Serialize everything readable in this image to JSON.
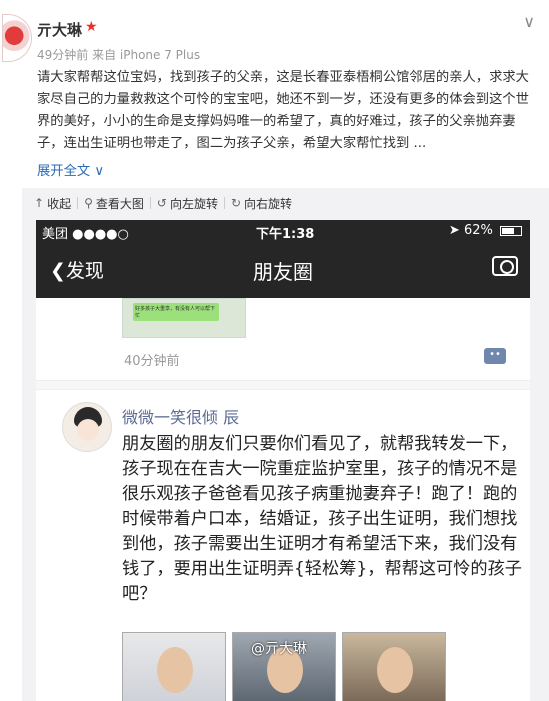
{
  "post": {
    "username": "亓大琳",
    "meta": "49分钟前 来自 iPhone 7 Plus",
    "text": "请大家帮帮这位宝妈，找到孩子的父亲，这是长春亚泰梧桐公馆邻居的亲人，求求大家尽自己的力量救救这个可怜的宝宝吧，她还不到一岁，还没有更多的体会到这个世界的美好，小小的生命是支撑妈妈唯一的希望了，真的好难过，孩子的父亲抛弃妻子，连出生证明也带走了，图二为孩子父亲，希望大家帮忙找到 ...",
    "expand_label": "展开全文 ∨",
    "colors": {
      "link": "#2a6bb5",
      "star": "#e8312f"
    }
  },
  "toolbar": {
    "collapse": "收起",
    "view_large": "查看大图",
    "rotate_left": "向左旋转",
    "rotate_right": "向右旋转"
  },
  "phone": {
    "carrier": "美团 ●●●●○",
    "time": "下午1:38",
    "battery": "62%",
    "back_label": "发现",
    "title": "朋友圈",
    "prev_time": "40分钟前",
    "prev_bubble": "好多孩子大重享，有没有人可以帮下忙",
    "moment_name": "微微一笑很倾 辰",
    "moment_text": "朋友圈的朋友们只要你们看见了，就帮我转发一下，孩子现在在吉大一院重症监护室里，孩子的情况不是很乐观孩子爸爸看见孩子病重抛妻弃子！跑了！跑的时候带着户口本，结婚证，孩子出生证明，我们想找到他，孩子需要出生证明才有希望活下来，我们没有钱了，要用出生证明弄{轻松筹}，帮帮这可怜的孩子吧？",
    "watermark": "@亓大琳",
    "colors": {
      "bar": "#262626",
      "name": "#5b6b92"
    }
  }
}
